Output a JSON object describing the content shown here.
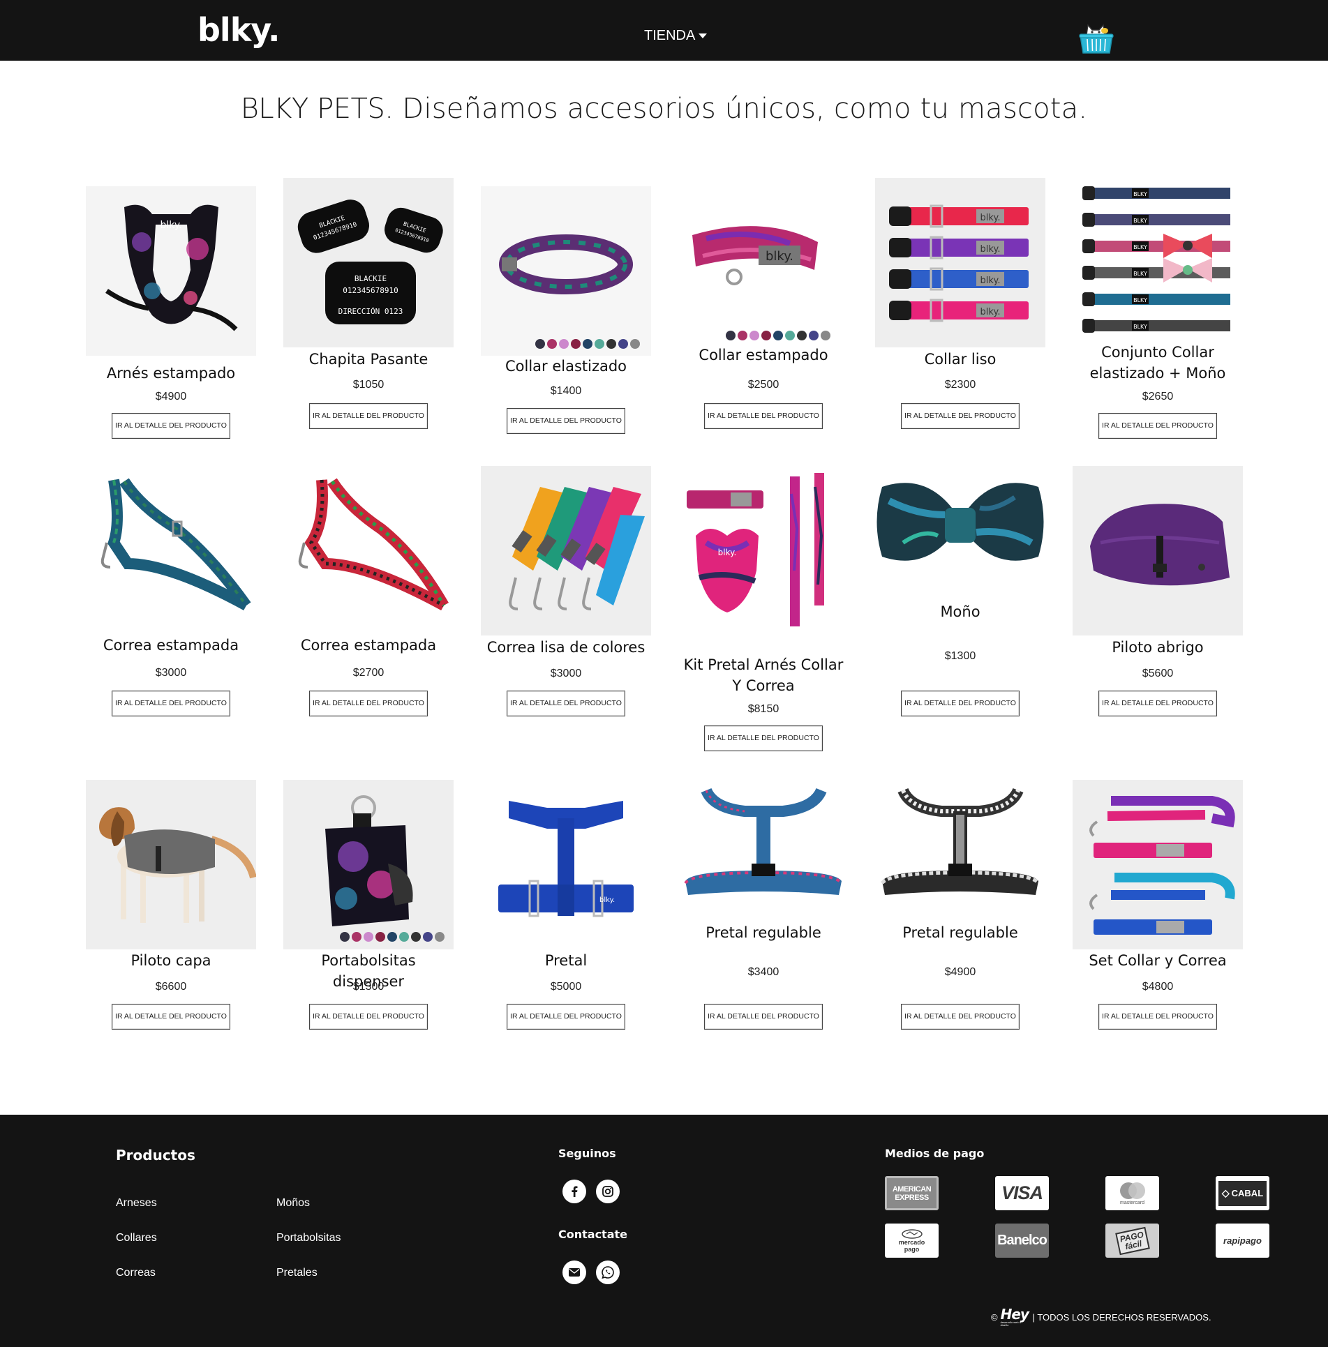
{
  "header": {
    "logo": "blky.",
    "nav_tienda": "TIENDA",
    "colors": {
      "bar": "#141414",
      "cart": "#2ab7d6"
    }
  },
  "hero": {
    "brand": "BLKY PETS.",
    "text": " Diseñamos accesorios únicos, como tu mascota."
  },
  "products": [
    {
      "name": "Arnés estampado",
      "price": "$4900",
      "button": "IR AL DETALLE DEL PRODUCTO"
    },
    {
      "name": "Chapita Pasante",
      "price": "$1050",
      "button": "IR AL DETALLE DEL PRODUCTO",
      "tag_texts": [
        "BLACKIE",
        "012345678910",
        "DIRECCIÓN 0123"
      ]
    },
    {
      "name": "Collar elastizado",
      "price": "$1400",
      "button": "IR AL DETALLE DEL PRODUCTO"
    },
    {
      "name": "Collar estampado",
      "price": "$2500",
      "button": "IR AL DETALLE DEL PRODUCTO"
    },
    {
      "name": "Collar liso",
      "price": "$2300",
      "button": "IR AL DETALLE DEL PRODUCTO"
    },
    {
      "name": "Conjunto Collar elastizado + Moño",
      "price": "$2650",
      "button": "IR AL DETALLE DEL PRODUCTO"
    },
    {
      "name": "Correa estampada",
      "price": "$3000",
      "button": "IR AL DETALLE DEL PRODUCTO"
    },
    {
      "name": "Correa estampada",
      "price": "$2700",
      "button": "IR AL DETALLE DEL PRODUCTO"
    },
    {
      "name": "Correa lisa de colores",
      "price": "$3000",
      "button": "IR AL DETALLE DEL PRODUCTO"
    },
    {
      "name": "Kit Pretal Arnés Collar Y Correa",
      "price": "$8150",
      "button": "IR AL DETALLE DEL PRODUCTO"
    },
    {
      "name": "Moño",
      "price": "$1300",
      "button": "IR AL DETALLE DEL PRODUCTO"
    },
    {
      "name": "Piloto abrigo",
      "price": "$5600",
      "button": "IR AL DETALLE DEL PRODUCTO"
    },
    {
      "name": "Piloto capa",
      "price": "$6600",
      "button": "IR AL DETALLE DEL PRODUCTO"
    },
    {
      "name": "Portabolsitas dispenser",
      "price": "$1300",
      "button": "IR AL DETALLE DEL PRODUCTO"
    },
    {
      "name": "Pretal",
      "price": "$5000",
      "button": "IR AL DETALLE DEL PRODUCTO"
    },
    {
      "name": "Pretal regulable",
      "price": "$3400",
      "button": "IR AL DETALLE DEL PRODUCTO"
    },
    {
      "name": "Pretal regulable",
      "price": "$4900",
      "button": "IR AL DETALLE DEL PRODUCTO"
    },
    {
      "name": "Set Collar y Correa",
      "price": "$4800",
      "button": "IR AL DETALLE DEL PRODUCTO"
    }
  ],
  "footer": {
    "productos_title": "Productos",
    "productos_links": [
      "Arneses",
      "Collares",
      "Correas",
      "Moños",
      "Portabolsitas",
      "Pretales"
    ],
    "seguinos_title": "Seguinos",
    "contactate_title": "Contactate",
    "medios_title": "Medios de pago",
    "payment_methods": [
      "AMERICAN EXPRESS",
      "VISA",
      "mastercard",
      "CABAL",
      "mercado pago",
      "Banelco",
      "PAGO fácil",
      "rapipago"
    ],
    "copyright_symbol": "©",
    "credit_logo": "Hey",
    "credit_sub": "desarrollo web & diseño",
    "rights": "| TODOS LOS DERECHOS RESERVADOS."
  }
}
